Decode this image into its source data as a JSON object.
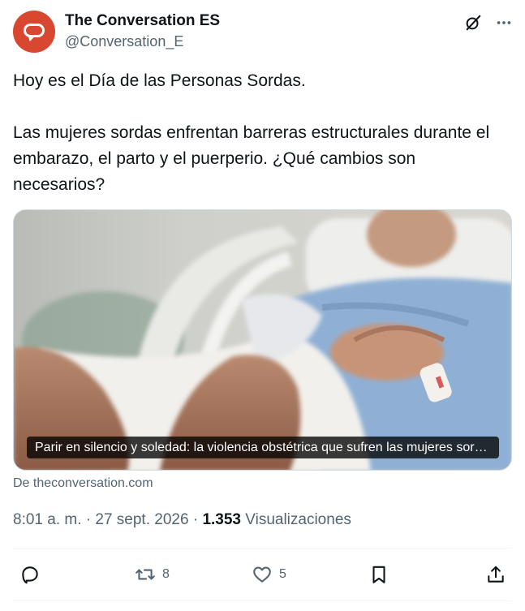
{
  "account": {
    "name": "The Conversation ES",
    "handle": "@Conversation_E",
    "brand_color": "#d8472f"
  },
  "header_icons": {
    "grok": "grok-icon",
    "more": "more-icon"
  },
  "tweet": {
    "line1": "Hoy es el Día de las Personas Sordas.",
    "line2": "Las mujeres sordas enfrentan barreras estructurales durante el embarazo, el parto y el puerperio. ¿Qué cambios son necesarios?"
  },
  "card": {
    "caption": "Parir en silencio y soledad: la violencia obstétrica que sufren las mujeres sordas",
    "source": "De theconversation.com"
  },
  "meta": {
    "time": "8:01 a. m.",
    "separator": " · ",
    "date": "27 sept. 2026",
    "views_count": "1.353",
    "views_label": "Visualizaciones"
  },
  "actions": {
    "reply": {
      "icon": "reply-icon",
      "count": ""
    },
    "retweet": {
      "icon": "retweet-icon",
      "count": "8"
    },
    "like": {
      "icon": "heart-icon",
      "count": "5"
    },
    "bookmark": {
      "icon": "bookmark-icon",
      "count": ""
    },
    "share": {
      "icon": "share-icon",
      "count": ""
    }
  },
  "colors": {
    "text": "#0f1419",
    "secondary": "#536471",
    "divider": "#eff3f4"
  }
}
